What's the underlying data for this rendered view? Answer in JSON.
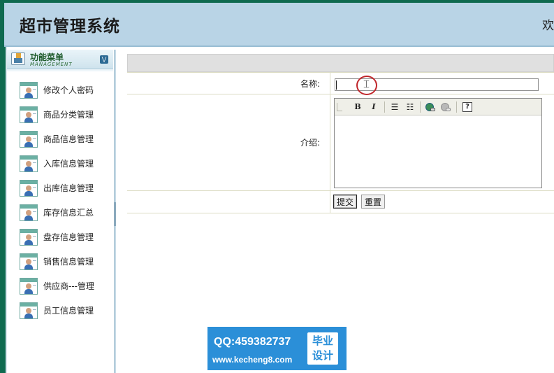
{
  "header": {
    "title": "超市管理系统",
    "welcome": "欢"
  },
  "sidebar": {
    "menu_title": "功能菜单",
    "menu_subtitle": "MANAGEMENT",
    "items": [
      {
        "label": "修改个人密码"
      },
      {
        "label": "商品分类管理"
      },
      {
        "label": "商品信息管理"
      },
      {
        "label": "入库信息管理"
      },
      {
        "label": "出库信息管理"
      },
      {
        "label": "库存信息汇总"
      },
      {
        "label": "盘存信息管理"
      },
      {
        "label": "销售信息管理"
      },
      {
        "label": "供应商---管理"
      },
      {
        "label": "员工信息管理"
      }
    ]
  },
  "form": {
    "name_label": "名称:",
    "name_value": "",
    "intro_label": "介绍:",
    "editor_toolbar": {
      "bold": "B",
      "italic": "I",
      "ordered_list": "☰",
      "unordered_list": "☷",
      "help": "?"
    },
    "submit_label": "提交",
    "reset_label": "重置"
  },
  "watermark": {
    "qq": "QQ:459382737",
    "site": "www.kecheng8.com",
    "badge_line1": "毕业",
    "badge_line2": "设计"
  }
}
